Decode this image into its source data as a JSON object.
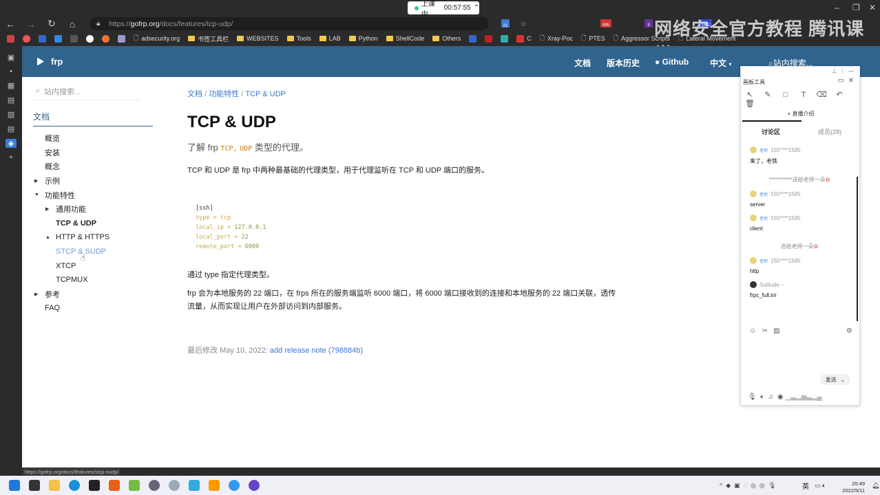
{
  "browser": {
    "timer_label": "上课中",
    "timer": "00:57:55",
    "url_prefix": "https://",
    "url_domain": "gofrp.org",
    "url_path": "/docs/features/tcp-udp/",
    "bookmarks": [
      "adsecurity.org",
      "书签工具栏",
      "WEBSITES",
      "Tools",
      "LAB",
      "Python",
      "ShellCode",
      "Others",
      "C",
      "Xray-Poc",
      "PTES",
      "Aggressor Scripts",
      "Lateral Movement"
    ],
    "ext_badges": [
      "21",
      "895",
      "9",
      "1462"
    ],
    "watermark": "网络安全官方教程  腾讯课堂",
    "status_url": "https://gofrp.org/docs/features/stcp-sudp/"
  },
  "navbar": {
    "brand": "frp",
    "links": [
      "文档",
      "版本历史",
      "Github",
      "中文",
      "站内搜索..."
    ]
  },
  "sidebar": {
    "search_placeholder": "站内搜索...",
    "section": "文档",
    "items": [
      {
        "label": "概览"
      },
      {
        "label": "安装"
      },
      {
        "label": "概念"
      },
      {
        "label": "示例"
      },
      {
        "label": "功能特性"
      },
      {
        "label": "通用功能"
      },
      {
        "label": "TCP & UDP"
      },
      {
        "label": "HTTP & HTTPS"
      },
      {
        "label": "STCP & SUDP"
      },
      {
        "label": "XTCP"
      },
      {
        "label": "TCPMUX"
      },
      {
        "label": "参考"
      },
      {
        "label": "FAQ"
      }
    ]
  },
  "main": {
    "breadcrumb": [
      "文档",
      "功能特性",
      "TCP & UDP"
    ],
    "title": "TCP & UDP",
    "lead_pre": "了解 frp",
    "lead_tcp": "TCP",
    "lead_udp": "UDP",
    "lead_post": "类型的代理。",
    "intro": "TCP 和 UDP 是 frp 中两种最基础的代理类型，用于代理监听在 TCP 和 UDP 端口的服务。",
    "code": {
      "section": "[ssh]",
      "lines": [
        [
          "type",
          "tcp"
        ],
        [
          "local_ip",
          "127.0.0.1"
        ],
        [
          "local_port",
          "22"
        ],
        [
          "remote_port",
          "6000"
        ]
      ]
    },
    "p1": "通过 type 指定代理类型。",
    "p2": "frp 会为本地服务的 22 端口，在 frps 所在的服务端监听 6000 端口，将 6000 端口接收到的连接和本地服务的 22 端口关联，透传流量，从而实现让用户在外部访问到内部服务。",
    "lastmod_label": "最后修改 May 10, 2022:",
    "lastmod_link": "add release note (798884b)"
  },
  "chat": {
    "title": "画板工具",
    "intro": "+ 直播介绍",
    "tab_discuss": "讨论区",
    "tab_members": "成员(28)",
    "teacher_tag": "老师",
    "messages": [
      {
        "user": "155****1585",
        "text": "来了，老铁"
      },
      {
        "gift": "***********送给老师一朵"
      },
      {
        "user": "155****1585",
        "text": "server"
      },
      {
        "user": "155****1585",
        "text": "client"
      },
      {
        "gift": "送给老师一朵"
      },
      {
        "user": "155****1585",
        "text": "http"
      },
      {
        "user": "Solitude ~",
        "text": "frpc_full.ini"
      }
    ],
    "send": "发送"
  },
  "taskbar": {
    "time": "20:49",
    "date": "2022/5/11",
    "ime": "英"
  }
}
